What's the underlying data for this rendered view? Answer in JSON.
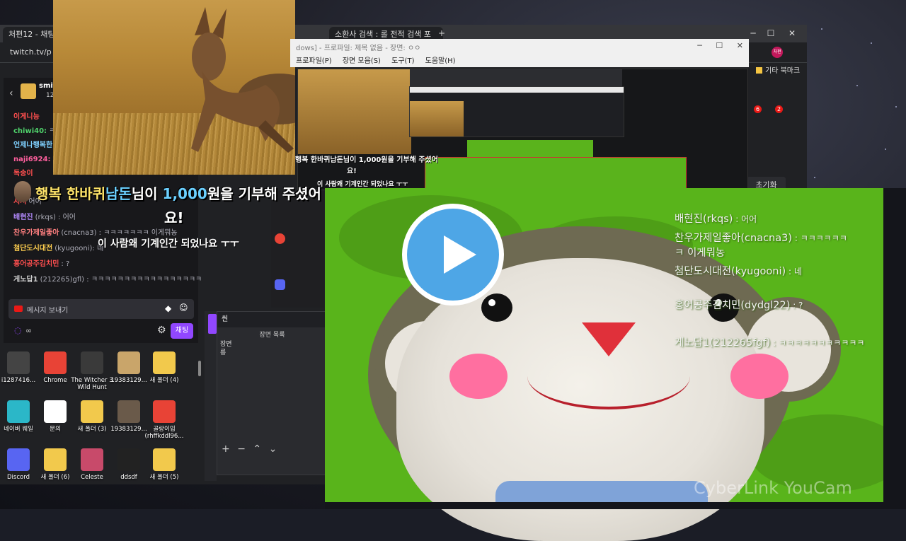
{
  "browser": {
    "tabs": [
      "처편12 - 채팅",
      "소환사 검색 : 롤 전적 검색 포"
    ],
    "url": "twitch.tv/p",
    "bookmark": "기타 북마크",
    "reset_label": "초기화",
    "badge_a": "6",
    "badge_b": "2",
    "avatar_label": "처편"
  },
  "inner_window": {
    "title": "dows] - 프로파일: 제목 없음 - 장면: ㅇㅇ",
    "menu": [
      "프로파일(P)",
      "장면 모음(S)",
      "도구(T)",
      "도움말(H)"
    ]
  },
  "chat": {
    "header_name": "smite",
    "header_count": "12",
    "lines": [
      {
        "user": "이게니능",
        "user_color": "#ff4f4f",
        "text": ""
      },
      {
        "user": "chiwi40:",
        "user_color": "#4fd16b",
        "text": "ㅋ"
      },
      {
        "user": "언제나행복한",
        "user_color": "#7fd0ff",
        "text": ""
      },
      {
        "user": "naji6924:",
        "user_color": "#ff5f9e",
        "text": "보"
      },
      {
        "user": "독송이",
        "user_color": "#ff4f4f",
        "text": ""
      },
      {
        "user": "서서",
        "user_color": "#ff4f4f",
        "text": "어어"
      },
      {
        "user": "배현진",
        "user_color": "#b48bff",
        "text": "(rkqs) : 어어"
      },
      {
        "user": "찬우가제일좋아",
        "user_color": "#ff7f7f",
        "text": "(cnacna3) : ㅋㅋㅋㅋㅋㅋㅋ 이게뭐농"
      },
      {
        "user": "첨단도시대전",
        "user_color": "#ffcf4f",
        "text": "(kyugooni): 네"
      },
      {
        "user": "홍어공주김치민",
        "user_color": "#ff4f4f",
        "text": ": ?"
      },
      {
        "user": "게노답1",
        "user_color": "#cfcfcf",
        "text": "(212265)gfl) : ㅋㅋㅋㅋㅋㅋㅋㅋㅋㅋㅋㅋㅋㅋㅋㅋㅋ"
      }
    ],
    "input_placeholder": "메시지 보내기",
    "send_label": "채팅",
    "infinity": "∞"
  },
  "donation": {
    "prefix": "행복 한바퀴",
    "nick": "남돈",
    "mid": "님이 ",
    "amount": "1,000",
    "suffix": "원을 기부해 주셨어",
    "line2": "요!",
    "message": "이 사람왜 기계인간 되었나요 ㅜㅜ",
    "small": "행복 한바퀴남돈님이 1,000원을 기부해 주셨어",
    "small_line2": "요!",
    "small_msg": "이 사람왜 기계인간 되었나요 ㅜㅜ"
  },
  "obs": {
    "header": "씬",
    "sub": "장면 목록",
    "items": [
      "장면",
      "릉"
    ]
  },
  "desktop_icons": [
    {
      "label": "i1287416...",
      "color": "#444"
    },
    {
      "label": "Chrome",
      "color": "#e84336"
    },
    {
      "label": "The Witcher 3 Wild Hunt",
      "color": "#3a3a3a"
    },
    {
      "label": "19383129...",
      "color": "#c9a56a"
    },
    {
      "label": "새 폴더 (4)",
      "color": "#f2c94c"
    },
    {
      "label": "네이버 웨일",
      "color": "#2bb7c8"
    },
    {
      "label": "문의",
      "color": "#ffffff"
    },
    {
      "label": "새 폴더 (3)",
      "color": "#f2c94c"
    },
    {
      "label": "19383129...",
      "color": "#6a5a4a"
    },
    {
      "label": "골랑이입 (rhffkddl96...",
      "color": "#e84336"
    },
    {
      "label": "Discord",
      "color": "#5865f2"
    },
    {
      "label": "새 폴더 (6)",
      "color": "#f2c94c"
    },
    {
      "label": "Celeste",
      "color": "#c84a6a"
    },
    {
      "label": "ddsdf",
      "color": "#222"
    },
    {
      "label": "새 폴더 (5)",
      "color": "#f2c94c"
    }
  ],
  "cam_chat": [
    {
      "name": "배현진(rkqs)",
      "text": " : 어어"
    },
    {
      "name": "찬우가제일좋아(cnacna3)",
      "text": " : ㅋㅋㅋㅋㅋㅋ"
    },
    {
      "name": "ㅋ 이게뭐농",
      "text": ""
    },
    {
      "name": "첨단도시대전(kyugooni)",
      "text": " : 네"
    },
    {
      "name": "홍어공주김치민(dydgl22)",
      "text": " : ?"
    },
    {
      "name": "게노답1(212265fgf)",
      "text": " : ㅋㅋㅋㅋㅋㅋㅋㅋㅋㅋㅋ"
    }
  ],
  "webcam_logo": "CyberLink YouCam",
  "colors": {
    "accent": "#9147ff",
    "play": "#4ea6e6",
    "cam_bg": "#59b41b"
  }
}
